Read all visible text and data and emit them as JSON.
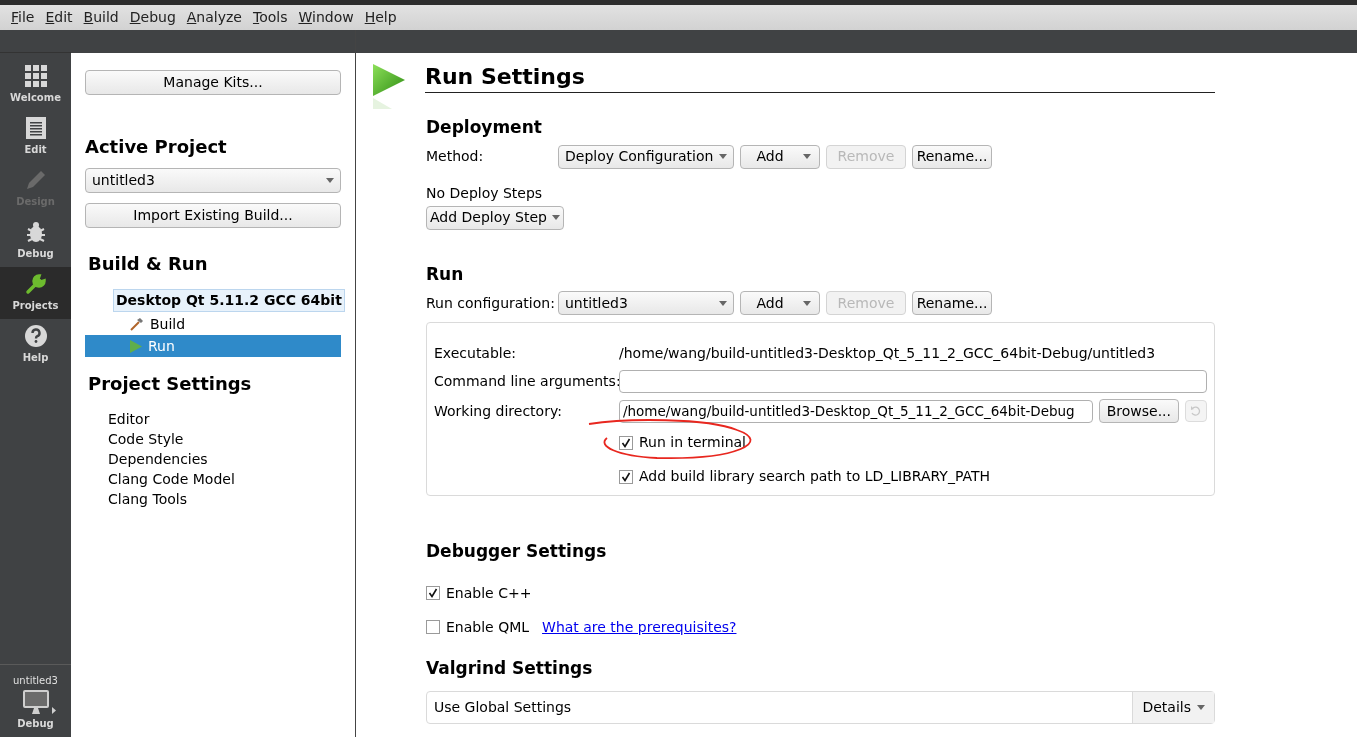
{
  "menu": [
    "File",
    "Edit",
    "Build",
    "Debug",
    "Analyze",
    "Tools",
    "Window",
    "Help"
  ],
  "mode_bar": {
    "items": [
      {
        "label": "Welcome",
        "kind": "grid",
        "selected": false,
        "disabled": false
      },
      {
        "label": "Edit",
        "kind": "document",
        "selected": false,
        "disabled": false
      },
      {
        "label": "Design",
        "kind": "pencil",
        "selected": false,
        "disabled": true
      },
      {
        "label": "Debug",
        "kind": "bug",
        "selected": false,
        "disabled": false
      },
      {
        "label": "Projects",
        "kind": "wrench",
        "selected": true,
        "disabled": false
      },
      {
        "label": "Help",
        "kind": "help",
        "selected": false,
        "disabled": false
      }
    ],
    "project": "untitled3",
    "target": "Debug"
  },
  "projects_panel": {
    "manage_kits": "Manage Kits...",
    "active_project_heading": "Active Project",
    "project_value": "untitled3",
    "import_build": "Import Existing Build...",
    "build_run_heading": "Build & Run",
    "kit": "Desktop Qt 5.11.2 GCC 64bit",
    "steps": [
      {
        "label": "Build",
        "kind": "build",
        "selected": false
      },
      {
        "label": "Run",
        "kind": "run",
        "selected": true
      }
    ],
    "settings_heading": "Project Settings",
    "settings_items": [
      "Editor",
      "Code Style",
      "Dependencies",
      "Clang Code Model",
      "Clang Tools"
    ]
  },
  "run_settings": {
    "title": "Run Settings",
    "deployment": {
      "heading": "Deployment",
      "method_label": "Method:",
      "method_value": "Deploy Configuration",
      "buttons": [
        {
          "label": "Add",
          "kind": "dropdown",
          "disabled": false
        },
        {
          "label": "Remove",
          "kind": "plain",
          "disabled": true
        },
        {
          "label": "Rename...",
          "kind": "plain",
          "disabled": false
        }
      ],
      "no_steps": "No Deploy Steps",
      "add_step": "Add Deploy Step"
    },
    "run": {
      "heading": "Run",
      "config_label": "Run configuration:",
      "config_value": "untitled3",
      "buttons": [
        {
          "label": "Add",
          "kind": "dropdown",
          "disabled": false
        },
        {
          "label": "Remove",
          "kind": "plain",
          "disabled": true
        },
        {
          "label": "Rename...",
          "kind": "plain",
          "disabled": false
        }
      ],
      "executable_label": "Executable:",
      "executable_value": "/home/wang/build-untitled3-Desktop_Qt_5_11_2_GCC_64bit-Debug/untitled3",
      "args_label": "Command line arguments:",
      "workdir_label": "Working directory:",
      "workdir_value": "/home/wang/build-untitled3-Desktop_Qt_5_11_2_GCC_64bit-Debug",
      "browse": "Browse...",
      "reset_disabled": true,
      "checkboxes": [
        {
          "label": "Run in terminal",
          "checked": true,
          "circled": true
        },
        {
          "label": "Add build library search path to LD_LIBRARY_PATH",
          "checked": true,
          "circled": false
        }
      ]
    },
    "debugger": {
      "heading": "Debugger Settings",
      "items": [
        {
          "label": "Enable C++",
          "checked": true
        },
        {
          "label": "Enable QML",
          "checked": false
        }
      ],
      "link": "What are the prerequisites?"
    },
    "valgrind": {
      "heading": "Valgrind Settings",
      "value": "Use Global Settings",
      "details": "Details"
    }
  }
}
